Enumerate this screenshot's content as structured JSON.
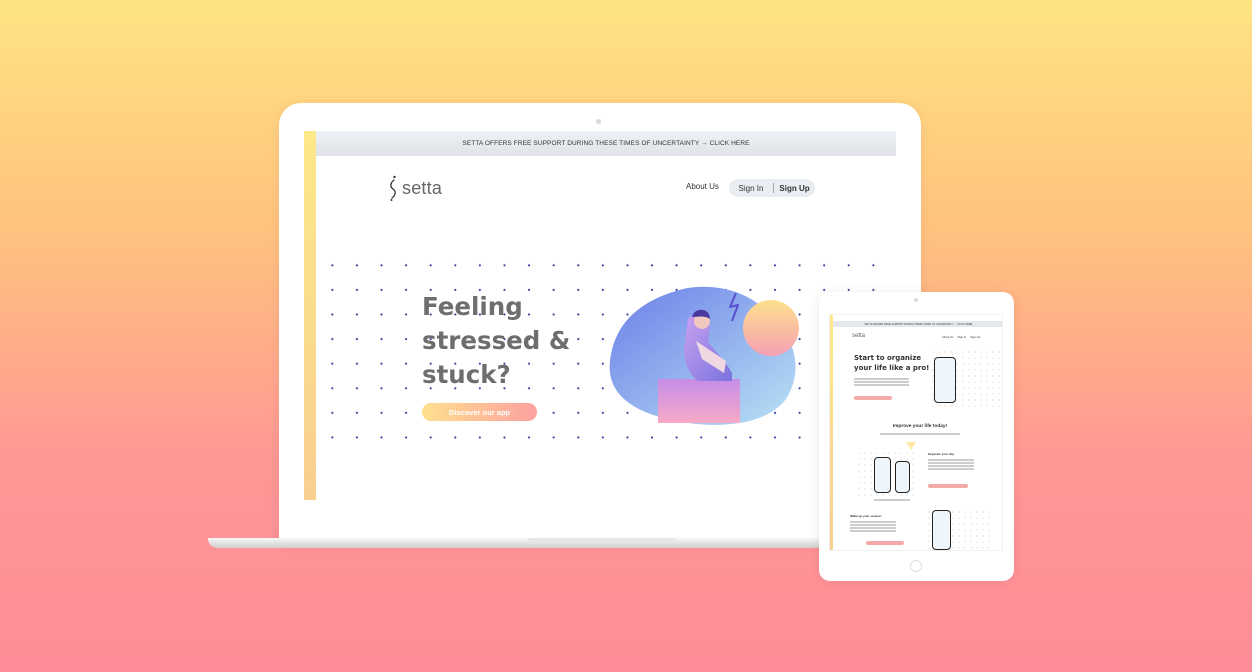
{
  "banner": {
    "text": "SETTA OFFERS FREE SUPPORT DURING THESE TIMES OF UNCERTAINTY → CLICK HERE"
  },
  "brand": {
    "name": "setta"
  },
  "nav": {
    "about": "About Us",
    "sign_in": "Sign In",
    "sign_up": "Sign Up"
  },
  "hero": {
    "headline": "Feeling\nstressed &\nstuck?",
    "cta": "Discover our app"
  },
  "tablet": {
    "hero_title": "Start to organize\nyour life like a pro!",
    "section_title": "Improve your life today!",
    "feature1_title": "Organize your day",
    "feature2_title": "Wake up your senses!"
  },
  "colors": {
    "background_top": "#ffe482",
    "background_bottom": "#ff8c98",
    "cta_start": "#ffe08e",
    "cta_end": "#fca0a0",
    "dot": "#3340a0"
  },
  "icons": {
    "logo": "setta-s-logo-icon",
    "illustration": "stressed-person-illustration"
  }
}
